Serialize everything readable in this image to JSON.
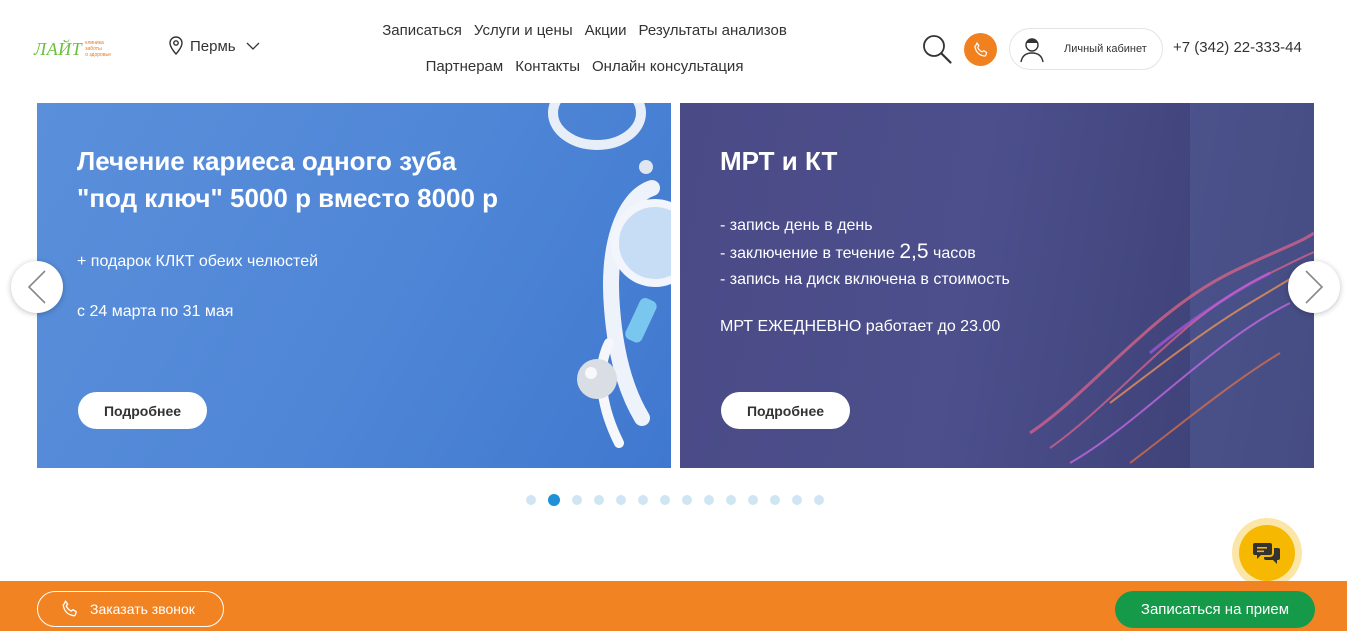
{
  "header": {
    "logo_word": "ЛАЙТ",
    "logo_sub": [
      "клиника",
      "заботы",
      "о здоровье"
    ],
    "city": "Пермь",
    "cabinet_label": "Личный кабинет",
    "phone": "+7 (342) 22-333-44"
  },
  "nav": {
    "items": [
      {
        "label": "Записаться"
      },
      {
        "label": "Услуги и цены"
      },
      {
        "label": "Акции"
      },
      {
        "label": "Результаты анализов"
      },
      {
        "label": "Партнерам"
      },
      {
        "label": "Контакты"
      },
      {
        "label": "Онлайн консультация"
      }
    ]
  },
  "slides": [
    {
      "title_line1": "Лечение кариеса одного зуба",
      "title_line2": "\"под ключ\" 5000 р вместо 8000 р",
      "text1": "+ подарок КЛКТ обеих челюстей",
      "text2": "с 24 марта по 31 мая",
      "button": "Подробнее"
    },
    {
      "title": "МРТ и КТ",
      "line1": "- запись день в день",
      "line2_pre": "- заключение в течение ",
      "line2_num": "2,5",
      "line2_post": " часов",
      "line3": "- запись на диск включена в стоимость",
      "line4": "МРТ ЕЖЕДНЕВНО работает до 23.00",
      "button": "Подробнее"
    }
  ],
  "carousel": {
    "total": 14,
    "active": 2
  },
  "bottom_bar": {
    "callback": "Заказать звонок",
    "book": "Записаться на прием"
  },
  "colors": {
    "accent_orange": "#f28322",
    "book_green": "#149a48",
    "dot_active": "#1f8fd8",
    "chat_yellow": "#f6b800"
  }
}
